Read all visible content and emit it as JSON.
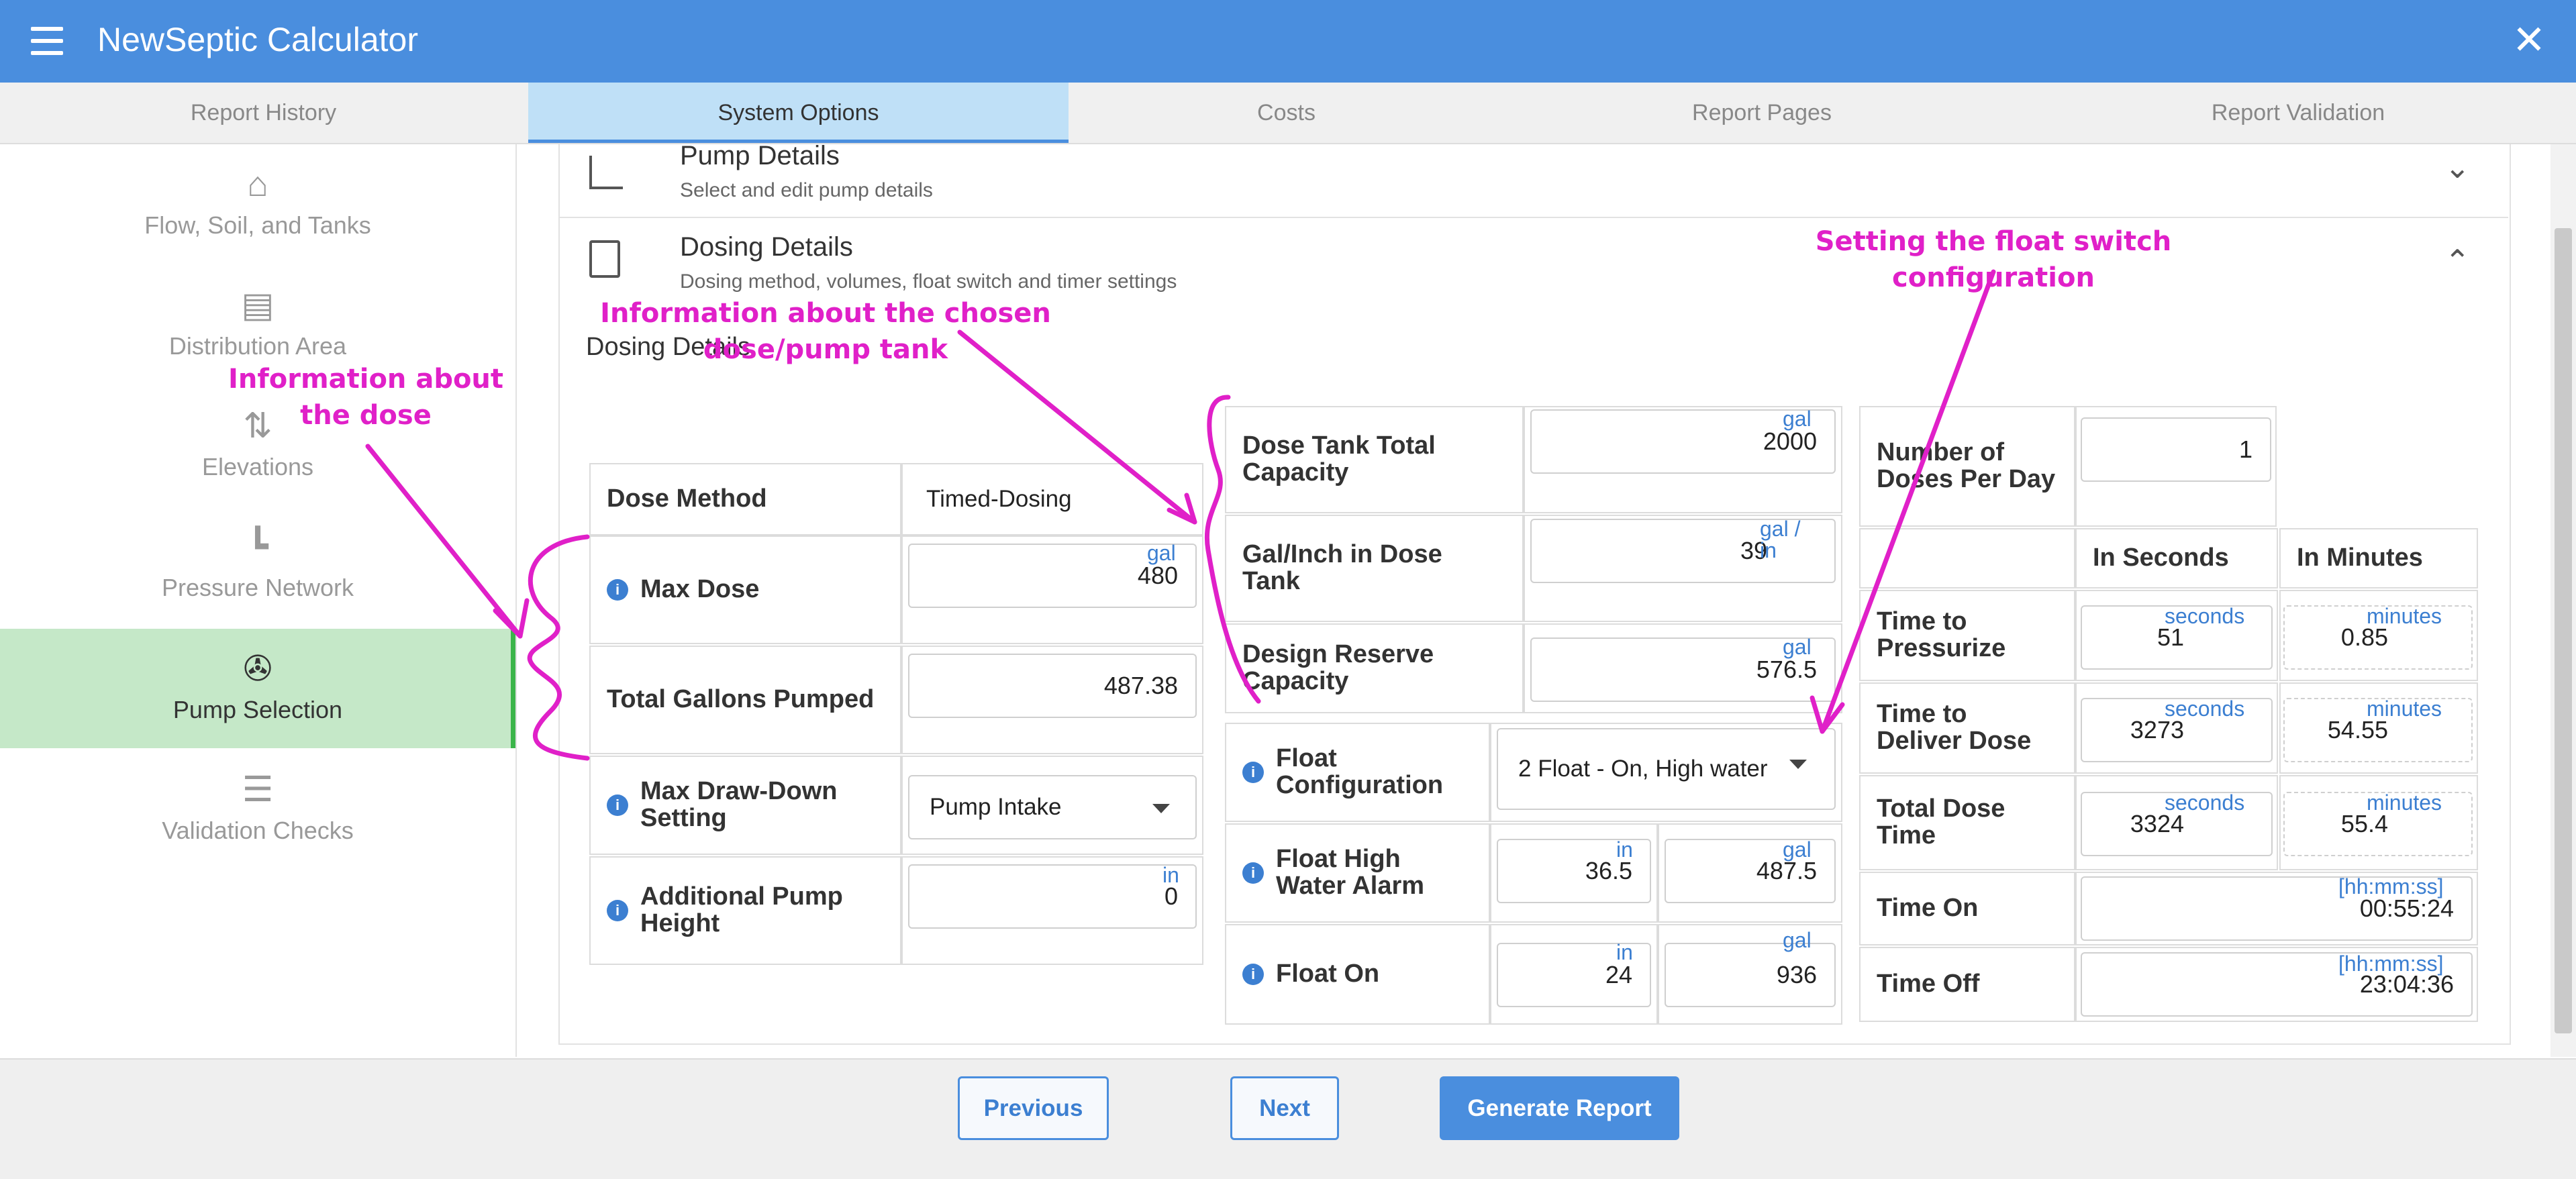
{
  "app": {
    "title": "NewSeptic Calculator"
  },
  "tabs": [
    {
      "label": "Report History"
    },
    {
      "label": "System Options"
    },
    {
      "label": "Costs"
    },
    {
      "label": "Report Pages"
    },
    {
      "label": "Report Validation"
    }
  ],
  "sidebar": {
    "items": [
      {
        "label": "Flow, Soil, and Tanks",
        "icon": "house-icon"
      },
      {
        "label": "Distribution Area",
        "icon": "bed-icon"
      },
      {
        "label": "Elevations",
        "icon": "elevation-icon"
      },
      {
        "label": "Pressure Network",
        "icon": "pipe-icon"
      },
      {
        "label": "Pump Selection",
        "icon": "pump-icon"
      },
      {
        "label": "Validation Checks",
        "icon": "checklist-icon"
      }
    ]
  },
  "sections": {
    "pump": {
      "title": "Pump Details",
      "subtitle": "Select and edit pump details"
    },
    "dosing": {
      "title": "Dosing Details",
      "subtitle": "Dosing method, volumes, float switch and timer settings",
      "inner_title": "Dosing Details"
    }
  },
  "dose_table": {
    "dose_method": {
      "label": "Dose Method",
      "value": "Timed-Dosing"
    },
    "max_dose": {
      "label": "Max Dose",
      "value": "480",
      "unit": "gal"
    },
    "total_gallons": {
      "label": "Total Gallons Pumped",
      "value": "487.38"
    },
    "max_drawdown": {
      "label": "Max Draw-Down Setting",
      "value": "Pump Intake"
    },
    "additional_height": {
      "label": "Additional Pump Height",
      "value": "0",
      "unit": "in"
    }
  },
  "tank_table": {
    "total_capacity": {
      "label": "Dose Tank Total Capacity",
      "value": "2000",
      "unit": "gal"
    },
    "gal_per_inch": {
      "label": "Gal/Inch in Dose Tank",
      "value": "39",
      "unit": "gal / in"
    },
    "reserve": {
      "label": "Design Reserve Capacity",
      "value": "576.5",
      "unit": "gal"
    },
    "float_config": {
      "label": "Float Configuration",
      "value": "2 Float - On, High water"
    },
    "float_high": {
      "label": "Float High Water Alarm",
      "value_in": "36.5",
      "unit_in": "in",
      "value_gal": "487.5",
      "unit_gal": "gal"
    },
    "float_on": {
      "label": "Float On",
      "value_in": "24",
      "unit_in": "in",
      "value_gal": "936",
      "unit_gal": "gal"
    }
  },
  "timer_table": {
    "num_doses": {
      "label": "Number of Doses Per Day",
      "value": "1"
    },
    "col_seconds": "In Seconds",
    "col_minutes": "In Minutes",
    "pressurize": {
      "label": "Time to Pressurize",
      "seconds": "51",
      "minutes": "0.85"
    },
    "deliver": {
      "label": "Time to Deliver Dose",
      "seconds": "3273",
      "minutes": "54.55"
    },
    "total": {
      "label": "Total Dose Time",
      "seconds": "3324",
      "minutes": "55.4"
    },
    "unit_seconds": "seconds",
    "unit_minutes": "minutes",
    "time_on": {
      "label": "Time On",
      "value": "00:55:24",
      "unit": "[hh:mm:ss]"
    },
    "time_off": {
      "label": "Time Off",
      "value": "23:04:36",
      "unit": "[hh:mm:ss]"
    }
  },
  "annotations": {
    "dose": "Information about the dose",
    "tank": "Information about the chosen dose/pump tank",
    "float": "Setting the float switch configuration"
  },
  "footer": {
    "previous": "Previous",
    "next": "Next",
    "generate": "Generate Report"
  },
  "colors": {
    "header": "#4a8ede",
    "active_tab": "#bfe0f7",
    "active_sidebar": "#c5e8c8",
    "annotation": "#e020c8",
    "unit_text": "#3c7fd1"
  }
}
